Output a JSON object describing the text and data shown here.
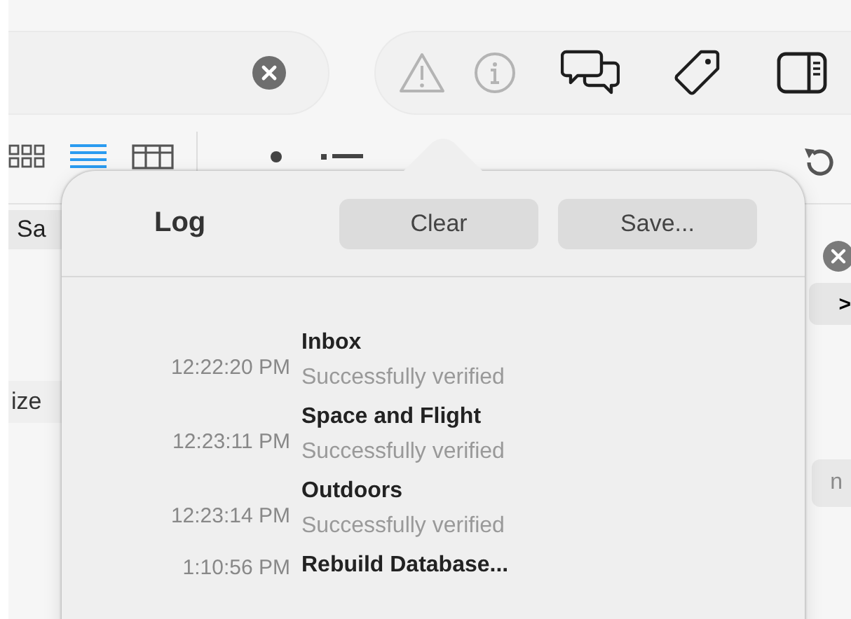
{
  "toolbar": {
    "buttons": [
      {
        "kind": "warning",
        "disabled": true
      },
      {
        "kind": "info",
        "disabled": true
      },
      {
        "kind": "chat",
        "disabled": false
      },
      {
        "kind": "tag",
        "disabled": false
      },
      {
        "kind": "sidebar",
        "disabled": false
      }
    ]
  },
  "view_modes": [
    {
      "kind": "grid",
      "selected": false
    },
    {
      "kind": "list",
      "selected": true
    },
    {
      "kind": "columns",
      "selected": false
    }
  ],
  "background": {
    "left_labels": [
      "Sa",
      "ize"
    ],
    "right_next": ">",
    "right_chip": "n"
  },
  "popover": {
    "title": "Log",
    "buttons": [
      "Clear",
      "Save..."
    ],
    "entries": [
      {
        "time": "12:22:20 PM",
        "title": "Inbox",
        "detail": "Successfully verified"
      },
      {
        "time": "12:23:11 PM",
        "title": "Space and Flight",
        "detail": "Successfully verified"
      },
      {
        "time": "12:23:14 PM",
        "title": "Outdoors",
        "detail": "Successfully verified"
      },
      {
        "time": "1:10:56 PM",
        "title": "Rebuild Database..."
      }
    ]
  }
}
